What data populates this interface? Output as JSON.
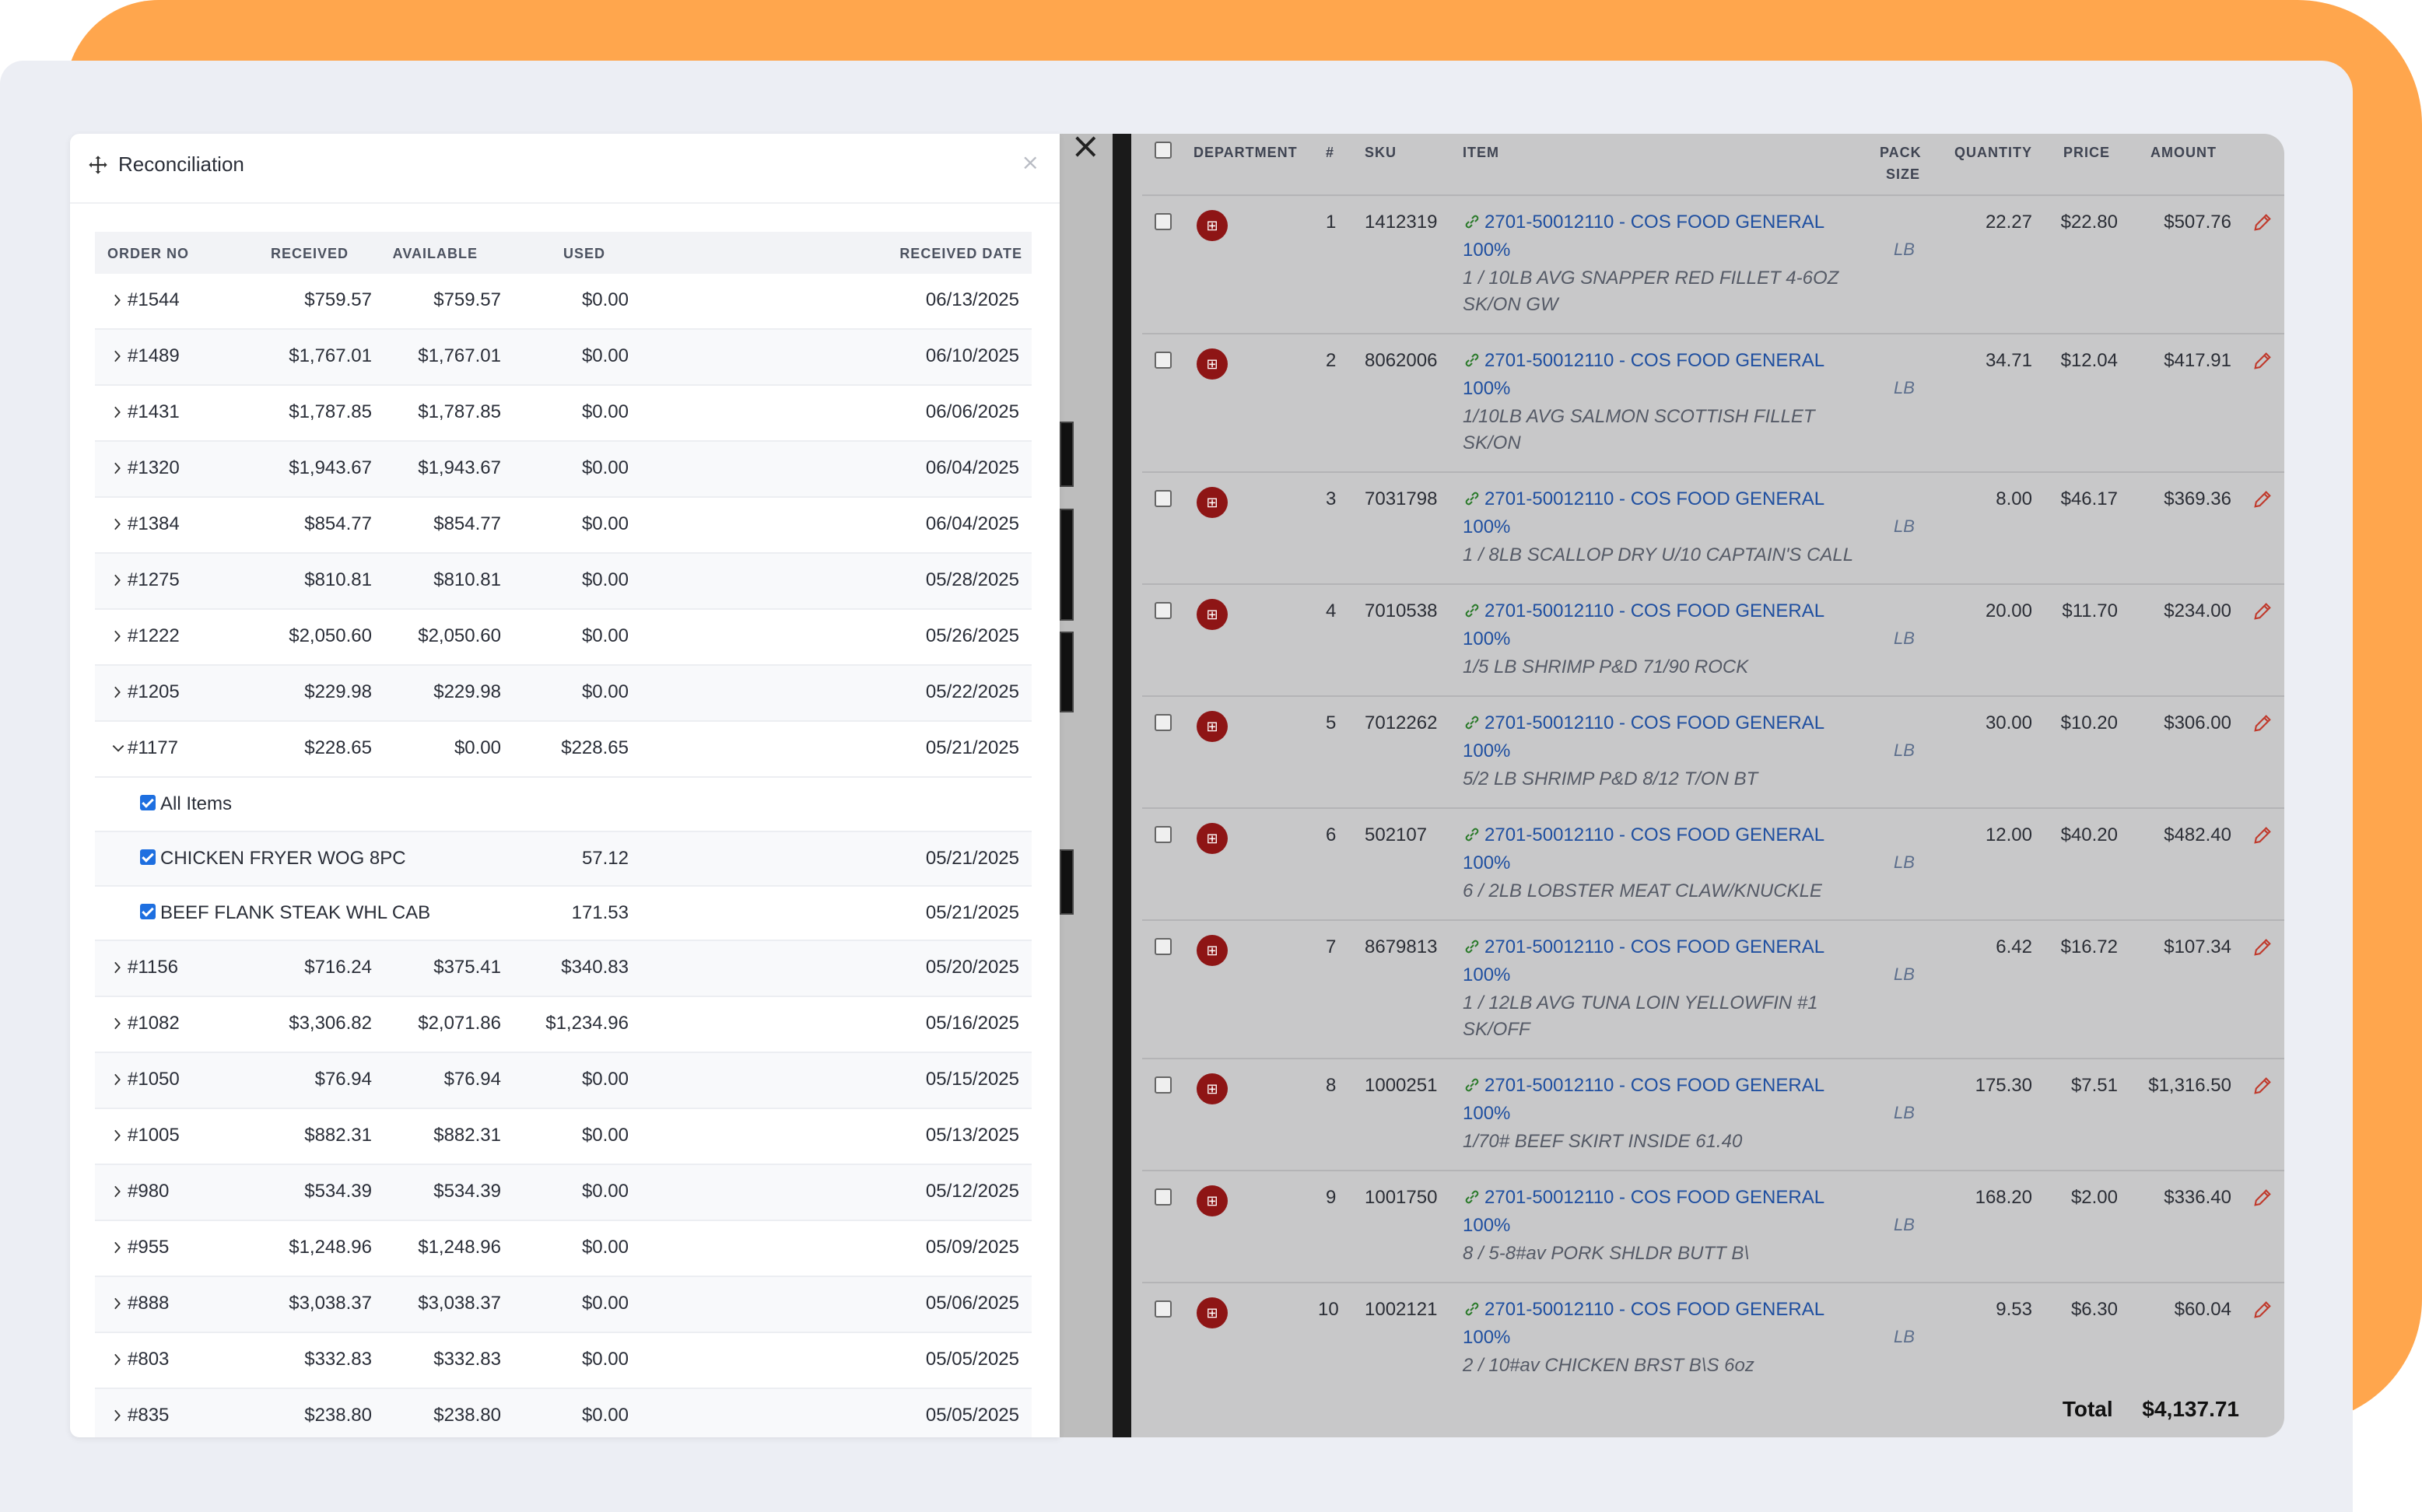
{
  "reconciliation": {
    "title": "Reconciliation",
    "close": "×",
    "columns": {
      "order_no": "ORDER NO",
      "received": "RECEIVED",
      "available": "AVAILABLE",
      "used": "USED",
      "received_date": "RECEIVED DATE"
    },
    "rows": [
      {
        "order": "#1544",
        "received": "$759.57",
        "available": "$759.57",
        "used": "$0.00",
        "date": "06/13/2025",
        "expanded": false
      },
      {
        "order": "#1489",
        "received": "$1,767.01",
        "available": "$1,767.01",
        "used": "$0.00",
        "date": "06/10/2025",
        "expanded": false
      },
      {
        "order": "#1431",
        "received": "$1,787.85",
        "available": "$1,787.85",
        "used": "$0.00",
        "date": "06/06/2025",
        "expanded": false
      },
      {
        "order": "#1320",
        "received": "$1,943.67",
        "available": "$1,943.67",
        "used": "$0.00",
        "date": "06/04/2025",
        "expanded": false
      },
      {
        "order": "#1384",
        "received": "$854.77",
        "available": "$854.77",
        "used": "$0.00",
        "date": "06/04/2025",
        "expanded": false
      },
      {
        "order": "#1275",
        "received": "$810.81",
        "available": "$810.81",
        "used": "$0.00",
        "date": "05/28/2025",
        "expanded": false
      },
      {
        "order": "#1222",
        "received": "$2,050.60",
        "available": "$2,050.60",
        "used": "$0.00",
        "date": "05/26/2025",
        "expanded": false
      },
      {
        "order": "#1205",
        "received": "$229.98",
        "available": "$229.98",
        "used": "$0.00",
        "date": "05/22/2025",
        "expanded": false
      },
      {
        "order": "#1177",
        "received": "$228.65",
        "available": "$0.00",
        "used": "$228.65",
        "date": "05/21/2025",
        "expanded": true
      }
    ],
    "expanded_items": {
      "all_label": "All Items",
      "items": [
        {
          "name": "CHICKEN FRYER WOG 8PC",
          "used": "57.12",
          "date": "05/21/2025"
        },
        {
          "name": "BEEF FLANK STEAK WHL CAB",
          "used": "171.53",
          "date": "05/21/2025"
        }
      ]
    },
    "rows_after": [
      {
        "order": "#1156",
        "received": "$716.24",
        "available": "$375.41",
        "used": "$340.83",
        "date": "05/20/2025"
      },
      {
        "order": "#1082",
        "received": "$3,306.82",
        "available": "$2,071.86",
        "used": "$1,234.96",
        "date": "05/16/2025"
      },
      {
        "order": "#1050",
        "received": "$76.94",
        "available": "$76.94",
        "used": "$0.00",
        "date": "05/15/2025"
      },
      {
        "order": "#1005",
        "received": "$882.31",
        "available": "$882.31",
        "used": "$0.00",
        "date": "05/13/2025"
      },
      {
        "order": "#980",
        "received": "$534.39",
        "available": "$534.39",
        "used": "$0.00",
        "date": "05/12/2025"
      },
      {
        "order": "#955",
        "received": "$1,248.96",
        "available": "$1,248.96",
        "used": "$0.00",
        "date": "05/09/2025"
      },
      {
        "order": "#888",
        "received": "$3,038.37",
        "available": "$3,038.37",
        "used": "$0.00",
        "date": "05/06/2025"
      },
      {
        "order": "#803",
        "received": "$332.83",
        "available": "$332.83",
        "used": "$0.00",
        "date": "05/05/2025"
      },
      {
        "order": "#835",
        "received": "$238.80",
        "available": "$238.80",
        "used": "$0.00",
        "date": "05/05/2025"
      }
    ]
  },
  "invoice": {
    "columns": {
      "department": "DEPARTMENT",
      "num": "#",
      "sku": "SKU",
      "item": "ITEM",
      "pack": "PACK",
      "size": "SIZE",
      "quantity": "QUANTITY",
      "price": "PRICE",
      "amount": "AMOUNT"
    },
    "rows": [
      {
        "num": "1",
        "sku": "1412319",
        "item": "2701-50012110 - COS FOOD GENERAL",
        "item2": "100%",
        "desc1": "1 / 10LB AVG SNAPPER RED FILLET 4-6OZ",
        "desc2": "SK/ON GW",
        "pack": "LB",
        "qty": "22.27",
        "price": "$22.80",
        "amount": "$507.76"
      },
      {
        "num": "2",
        "sku": "8062006",
        "item": "2701-50012110 - COS FOOD GENERAL",
        "item2": "100%",
        "desc1": "1/10LB AVG SALMON SCOTTISH FILLET",
        "desc2": "SK/ON",
        "pack": "LB",
        "qty": "34.71",
        "price": "$12.04",
        "amount": "$417.91"
      },
      {
        "num": "3",
        "sku": "7031798",
        "item": "2701-50012110 - COS FOOD GENERAL",
        "item2": "100%",
        "desc1": "1 / 8LB SCALLOP DRY U/10 CAPTAIN'S CALL",
        "desc2": "",
        "pack": "LB",
        "qty": "8.00",
        "price": "$46.17",
        "amount": "$369.36"
      },
      {
        "num": "4",
        "sku": "7010538",
        "item": "2701-50012110 - COS FOOD GENERAL",
        "item2": "100%",
        "desc1": "1/5 LB SHRIMP P&D 71/90 ROCK",
        "desc2": "",
        "pack": "LB",
        "qty": "20.00",
        "price": "$11.70",
        "amount": "$234.00"
      },
      {
        "num": "5",
        "sku": "7012262",
        "item": "2701-50012110 - COS FOOD GENERAL",
        "item2": "100%",
        "desc1": "5/2 LB SHRIMP P&D 8/12 T/ON BT",
        "desc2": "",
        "pack": "LB",
        "qty": "30.00",
        "price": "$10.20",
        "amount": "$306.00"
      },
      {
        "num": "6",
        "sku": "502107",
        "item": "2701-50012110 - COS FOOD GENERAL",
        "item2": "100%",
        "desc1": "6 / 2LB LOBSTER MEAT CLAW/KNUCKLE",
        "desc2": "",
        "pack": "LB",
        "qty": "12.00",
        "price": "$40.20",
        "amount": "$482.40"
      },
      {
        "num": "7",
        "sku": "8679813",
        "item": "2701-50012110 - COS FOOD GENERAL",
        "item2": "100%",
        "desc1": "1 / 12LB AVG TUNA LOIN YELLOWFIN #1",
        "desc2": "SK/OFF",
        "pack": "LB",
        "qty": "6.42",
        "price": "$16.72",
        "amount": "$107.34"
      },
      {
        "num": "8",
        "sku": "1000251",
        "item": "2701-50012110 - COS FOOD GENERAL",
        "item2": "100%",
        "desc1": "1/70# BEEF SKIRT INSIDE 61.40",
        "desc2": "",
        "pack": "LB",
        "qty": "175.30",
        "price": "$7.51",
        "amount": "$1,316.50"
      },
      {
        "num": "9",
        "sku": "1001750",
        "item": "2701-50012110 - COS FOOD GENERAL",
        "item2": "100%",
        "desc1": "8 / 5-8#av PORK SHLDR BUTT B\\",
        "desc2": "",
        "pack": "LB",
        "qty": "168.20",
        "price": "$2.00",
        "amount": "$336.40"
      },
      {
        "num": "10",
        "sku": "1002121",
        "item": "2701-50012110 - COS FOOD GENERAL",
        "item2": "100%",
        "desc1": "2 / 10#av CHICKEN BRST B\\S 6oz",
        "desc2": "",
        "pack": "LB",
        "qty": "9.53",
        "price": "$6.30",
        "amount": "$60.04"
      }
    ],
    "total_label": "Total",
    "total_value": "$4,137.71"
  },
  "colors": {
    "orange": "#ffa64d",
    "canvas": "#eceef4",
    "link": "#1f4fa0",
    "dept_icon": "#8e1515",
    "checkbox": "#1e6fe0"
  },
  "icons": {
    "move": "move-arrows-icon",
    "link": "link-icon",
    "edit": "pencil-icon",
    "dept": "basket-icon"
  }
}
